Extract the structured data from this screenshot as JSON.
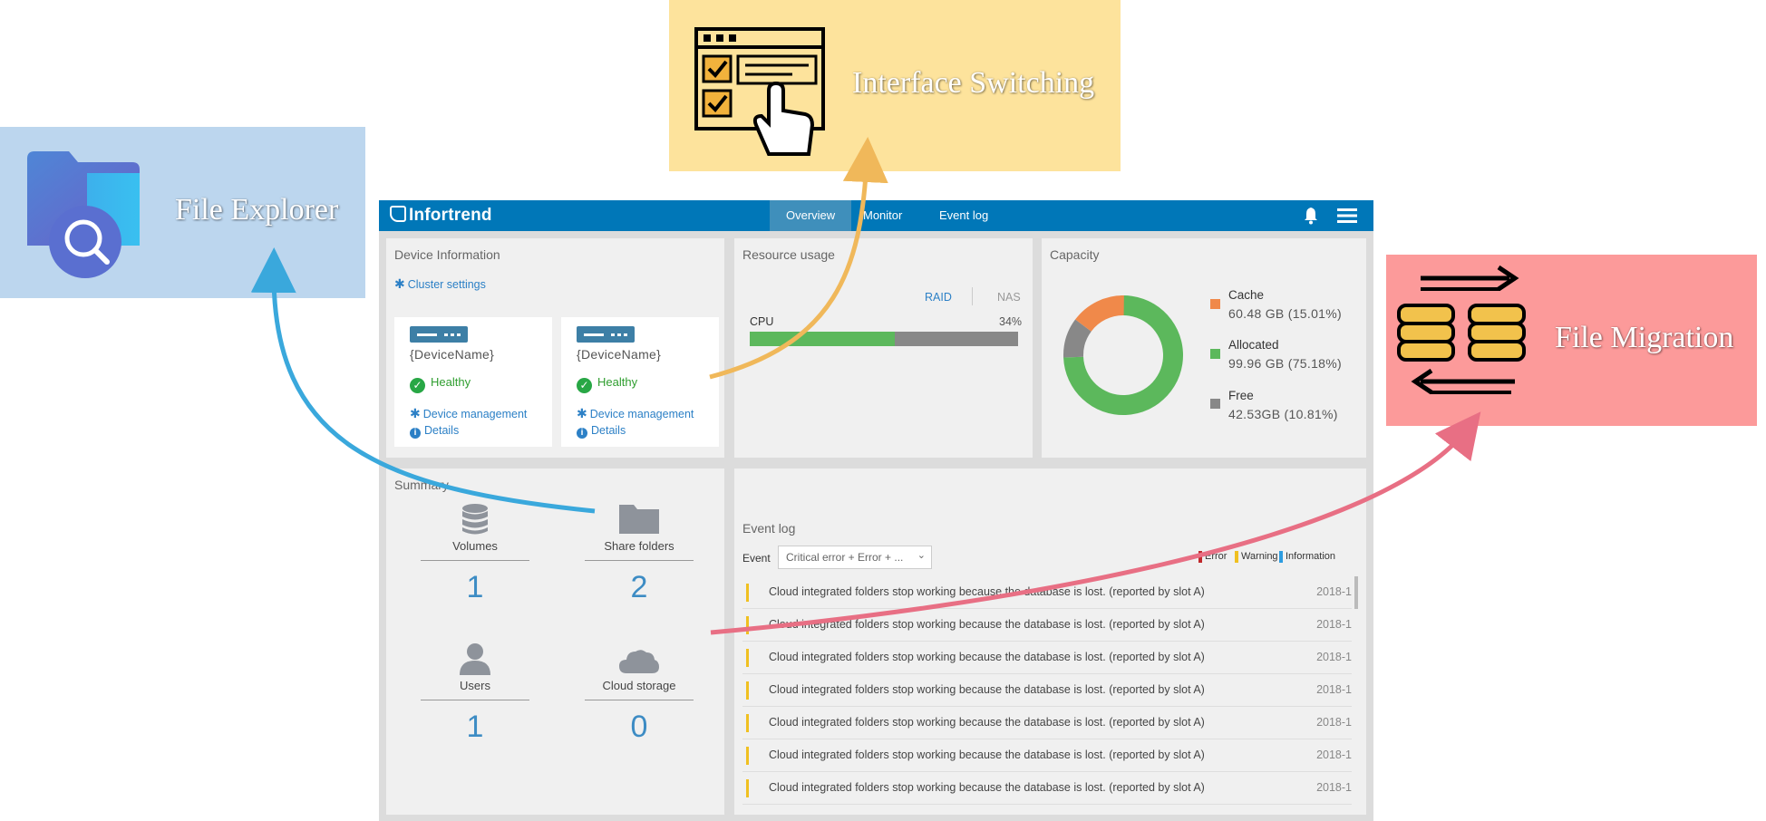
{
  "callouts": {
    "file_explorer": "File Explorer",
    "interface_switching": "Interface Switching",
    "file_migration": "File Migration"
  },
  "colors": {
    "topbar": "#0077b8",
    "file_explorer_box": "#bcd6ee",
    "interface_switching_box": "#fde39c",
    "file_migration_box": "#fc9a9a",
    "arrow_blue": "#3aa8dc",
    "arrow_orange": "#f0b85a",
    "arrow_pink": "#e86f84",
    "cpu_bar": "#5cb85c",
    "cache": "#f0894a",
    "allocated": "#5cb85c",
    "free": "#888888",
    "link": "#2c80c6"
  },
  "header": {
    "logo": "Infortrend",
    "tabs": [
      "Overview",
      "Monitor",
      "Event log"
    ],
    "active_tab": "Overview"
  },
  "device_info": {
    "title": "Device Information",
    "cluster_settings": "Cluster settings",
    "devices": [
      {
        "name": "{DeviceName}",
        "status": "Healthy",
        "management": "Device management",
        "details": "Details"
      },
      {
        "name": "{DeviceName}",
        "status": "Healthy",
        "management": "Device management",
        "details": "Details"
      }
    ]
  },
  "resource_usage": {
    "title": "Resource usage",
    "toggle": [
      "RAID",
      "NAS"
    ],
    "active_toggle": "RAID",
    "cpu_label": "CPU",
    "cpu_value": "34%",
    "cpu_fraction": 0.54
  },
  "capacity": {
    "title": "Capacity",
    "items": [
      {
        "name": "Cache",
        "value": "60.48 GB (15.01%)",
        "fraction": 0.1501
      },
      {
        "name": "Allocated",
        "value": "99.96 GB (75.18%)",
        "fraction": 0.7518
      },
      {
        "name": "Free",
        "value": "42.53GB (10.81%)",
        "fraction": 0.1081
      }
    ]
  },
  "summary": {
    "title": "Summary",
    "items": [
      {
        "label": "Volumes",
        "count": "1"
      },
      {
        "label": "Share folders",
        "count": "2"
      },
      {
        "label": "Users",
        "count": "1"
      },
      {
        "label": "Cloud storage",
        "count": "0"
      }
    ]
  },
  "event_log": {
    "title": "Event log",
    "filter_label": "Event",
    "filter_value": "Critical error + Error + ...",
    "legend": [
      "Error",
      "Warning",
      "Information"
    ],
    "rows": [
      {
        "message": "Cloud integrated folders stop working because the database is lost. (reported by slot A)",
        "date": "2018-1"
      },
      {
        "message": "Cloud integrated folders stop working because the database is lost. (reported by slot A)",
        "date": "2018-1"
      },
      {
        "message": "Cloud integrated folders stop working because the database is lost. (reported by slot A)",
        "date": "2018-1"
      },
      {
        "message": "Cloud integrated folders stop working because the database is lost. (reported by slot A)",
        "date": "2018-1"
      },
      {
        "message": "Cloud integrated folders stop working because the database is lost. (reported by slot A)",
        "date": "2018-1"
      },
      {
        "message": "Cloud integrated folders stop working because the database is lost. (reported by slot A)",
        "date": "2018-1"
      },
      {
        "message": "Cloud integrated folders stop working because the database is lost. (reported by slot A)",
        "date": "2018-1"
      }
    ]
  }
}
